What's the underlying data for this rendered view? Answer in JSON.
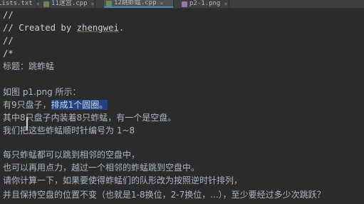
{
  "tabs": [
    {
      "label": "Lists.txt",
      "icon": "text-file-icon",
      "active": false
    },
    {
      "label": "11迷宫.cpp",
      "icon": "cpp-file-icon",
      "active": false
    },
    {
      "label": "12跳蚱蜢.cpp",
      "icon": "cpp-file-icon",
      "active": true
    },
    {
      "label": "p2-1.png",
      "icon": "image-file-icon",
      "active": false
    }
  ],
  "editor": {
    "lines": [
      "//",
      "// Created by ",
      "//",
      "/*",
      "标题：跳蚱蜢",
      "",
      "如图 p1.png 所示：",
      "有9只盘子，",
      "其中8只盘子内装着8只蚱蜢，有一个是空盘。",
      "我们把这些蚱蜢顺时针编号为 1~8",
      "",
      "每只蚱蜢都可以跳到相邻的空盘中，",
      "也可以再用点力，越过一个相邻的蚱蜢跳到空盘中。",
      "",
      "请你计算一下，如果要使得蚱蜢们的队形改为按照逆时针排列，",
      "并且保持空盘的位置不变（也就是1-8换位，2-7换位，...），至少要经过多少次跳跃？"
    ],
    "author": "zhengwei",
    "author_suffix": ".",
    "selected_text": "排成1个圆圈。"
  },
  "colors": {
    "background": "#2b2b2b",
    "text": "#a9b7c6",
    "selection": "#214283",
    "tab_active_border": "#4a88c7"
  }
}
